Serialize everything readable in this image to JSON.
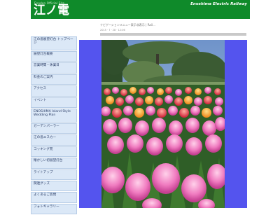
{
  "header": {
    "tagline": "Enoden Official Site",
    "logo": "江ノ電",
    "brand": "Enoshima Electric Railway"
  },
  "breadcrumb": {
    "text": "ナビゲーションメニュー表示非表示 | Rail...",
    "sub": "2015 · 7 · 28 · 12:06"
  },
  "sidebar": {
    "items": [
      {
        "label": "江の島展望灯台 トップページ"
      },
      {
        "label": "展望灯台概要"
      },
      {
        "label": "営業時間・休業日"
      },
      {
        "label": "料金のご案内"
      },
      {
        "label": "アクセス"
      },
      {
        "label": "イベント"
      },
      {
        "label": "ENOSHIMA Island Style Wedding Plan"
      },
      {
        "label": "ガーデンパーラー"
      },
      {
        "label": "江の島エスカー"
      },
      {
        "label": "コッキング苑"
      },
      {
        "label": "懐かしい初展望灯台"
      },
      {
        "label": "ライトアップ"
      },
      {
        "label": "関連グッズ"
      },
      {
        "label": "よくあるご質問"
      },
      {
        "label": "フォトギャラリー"
      }
    ]
  },
  "colors": {
    "header_green": "#0f8a2a",
    "frame_blue": "#5454ee",
    "nav_bg": "#dbe8f7"
  }
}
